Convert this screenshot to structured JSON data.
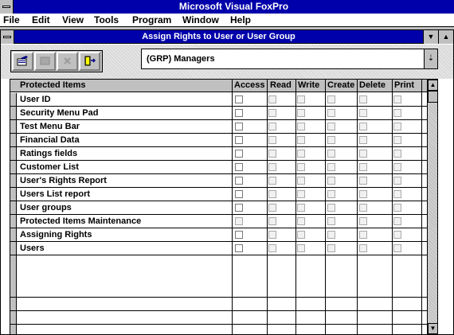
{
  "app": {
    "title": "Microsoft Visual FoxPro"
  },
  "menu": [
    "File",
    "Edit",
    "View",
    "Tools",
    "Program",
    "Window",
    "Help"
  ],
  "window": {
    "title": "Assign Rights to User or User Group"
  },
  "group_select": {
    "value": "(GRP) Managers"
  },
  "grid": {
    "columns": [
      "Protected Items",
      "Access",
      "Read",
      "Write",
      "Create",
      "Delete",
      "Print"
    ],
    "rows": [
      {
        "label": "User ID",
        "access": false,
        "read": false,
        "write": false,
        "create": false,
        "delete": false,
        "print": false
      },
      {
        "label": "Security Menu Pad",
        "access": false,
        "read": false,
        "write": false,
        "create": false,
        "delete": false,
        "print": false
      },
      {
        "label": "Test Menu Bar",
        "access": false,
        "read": false,
        "write": false,
        "create": false,
        "delete": false,
        "print": false
      },
      {
        "label": "Financial Data",
        "access": false,
        "read": false,
        "write": false,
        "create": false,
        "delete": false,
        "print": false
      },
      {
        "label": "Ratings fields",
        "access": false,
        "read": false,
        "write": false,
        "create": false,
        "delete": false,
        "print": false
      },
      {
        "label": "Customer List",
        "access": false,
        "read": false,
        "write": false,
        "create": false,
        "delete": false,
        "print": false
      },
      {
        "label": "User's Rights Report",
        "access": false,
        "read": false,
        "write": false,
        "create": false,
        "delete": false,
        "print": false
      },
      {
        "label": "Users List report",
        "access": false,
        "read": false,
        "write": false,
        "create": false,
        "delete": false,
        "print": false
      },
      {
        "label": "User groups",
        "access": false,
        "read": false,
        "write": false,
        "create": false,
        "delete": false,
        "print": false
      },
      {
        "label": "Protected Items Maintenance",
        "access": false,
        "read": false,
        "write": false,
        "create": false,
        "delete": false,
        "print": false
      },
      {
        "label": "Assigning Rights",
        "access": false,
        "read": false,
        "write": false,
        "create": false,
        "delete": false,
        "print": false
      },
      {
        "label": "Users",
        "access": false,
        "read": false,
        "write": false,
        "create": false,
        "delete": false,
        "print": false
      }
    ]
  },
  "icons": {
    "toolbar": [
      "edit-icon",
      "save-icon",
      "cancel-icon",
      "exit-icon"
    ],
    "combo_dropdown": "down-arrow-icon",
    "scroll_up": "up-arrow-icon",
    "scroll_down": "down-arrow-icon"
  },
  "colors": {
    "titlebar": "#0000aa",
    "face": "#c0c0c0",
    "highlight": "#ffffff"
  }
}
